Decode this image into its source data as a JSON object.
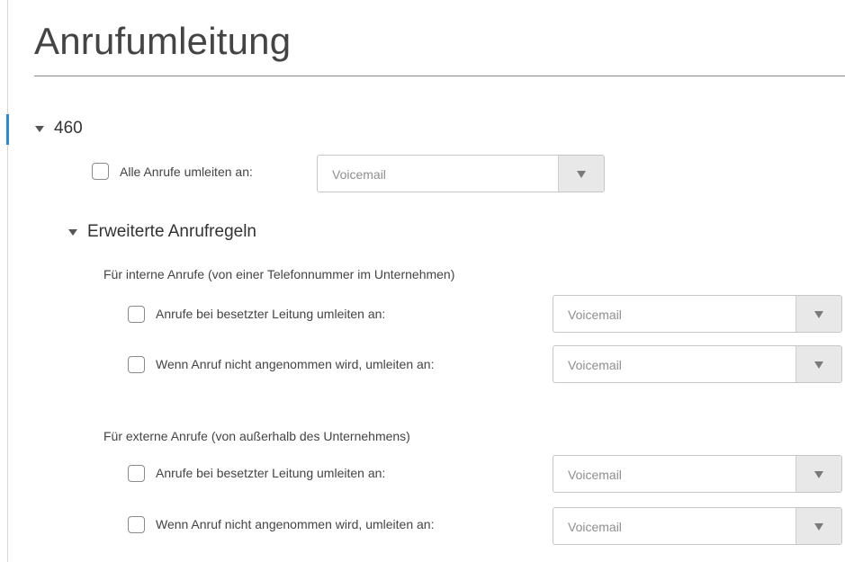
{
  "title": "Anrufumleitung",
  "line": {
    "number": "460",
    "all_calls_label": "Alle Anrufe umleiten an:",
    "all_calls_value": "Voicemail"
  },
  "advanced": {
    "heading": "Erweiterte Anrufregeln",
    "internal": {
      "heading": "Für interne Anrufe (von einer Telefonnummer im Unternehmen)",
      "busy_label": "Anrufe bei besetzter Leitung umleiten an:",
      "busy_value": "Voicemail",
      "noanswer_label": "Wenn Anruf nicht angenommen wird, umleiten an:",
      "noanswer_value": "Voicemail"
    },
    "external": {
      "heading": "Für externe Anrufe (von außerhalb des Unternehmens)",
      "busy_label": "Anrufe bei besetzter Leitung umleiten an:",
      "busy_value": "Voicemail",
      "noanswer_label": "Wenn Anruf nicht angenommen wird, umleiten an:",
      "noanswer_value": "Voicemail"
    }
  }
}
